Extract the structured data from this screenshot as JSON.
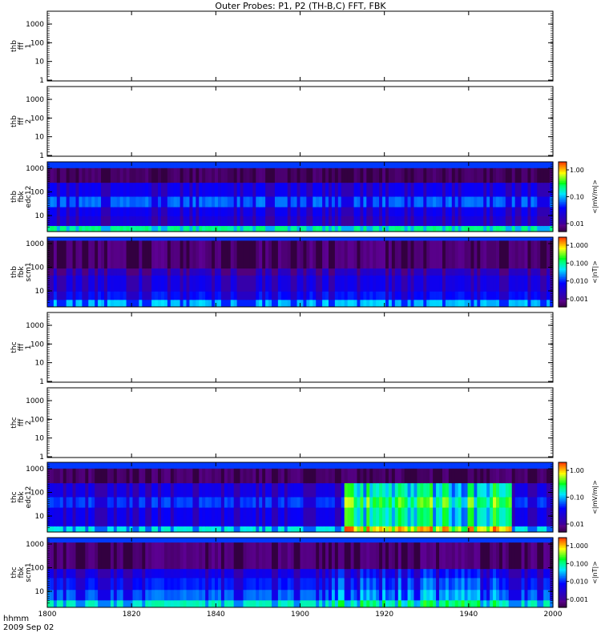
{
  "title": "Outer Probes: P1, P2 (TH-B,C) FFT, FBK",
  "xaxis": {
    "units_label": "hhmm",
    "date_label": "2009 Sep 02",
    "ticks": [
      "1800",
      "1820",
      "1840",
      "1900",
      "1920",
      "1940",
      "2000"
    ],
    "range_minutes": [
      0,
      120
    ]
  },
  "colors": {
    "frame": "#000000",
    "spectrogram_top_band": "#1f3cff",
    "background": "#ffffff"
  },
  "chart_data": [
    {
      "type": "heatmap",
      "ylabel_lines": [
        "thb",
        "fff",
        "1"
      ],
      "yscale": "log",
      "yticks": [
        "1",
        "10",
        "100",
        "1000"
      ],
      "ylim": [
        1,
        2000
      ],
      "data_present": false
    },
    {
      "type": "heatmap",
      "ylabel_lines": [
        "thb",
        "fff",
        "2"
      ],
      "yscale": "log",
      "yticks": [
        "1",
        "10",
        "100",
        "1000"
      ],
      "ylim": [
        1,
        2000
      ],
      "data_present": false
    },
    {
      "type": "heatmap",
      "ylabel_lines": [
        "thb",
        "fbk",
        "edc12"
      ],
      "yscale": "log",
      "yticks": [
        "10",
        "100",
        "1000"
      ],
      "colorbar": {
        "label": "<|mV/m|>",
        "ticks": [
          "1.00",
          "0.10",
          "0.01"
        ],
        "scale": "log"
      },
      "data_present": true,
      "bands_top_to_bottom": [
        "very high",
        "very low",
        "low",
        "low-mid",
        "low",
        "low",
        "high"
      ]
    },
    {
      "type": "heatmap",
      "ylabel_lines": [
        "thb",
        "fbk",
        "scm1"
      ],
      "yscale": "log",
      "yticks": [
        "10",
        "100",
        "1000"
      ],
      "colorbar": {
        "label": "<|nT|>",
        "ticks": [
          "1.000",
          "0.100",
          "0.010",
          "0.001"
        ],
        "scale": "log"
      },
      "data_present": true,
      "bands_top_to_bottom": [
        "high",
        "very low",
        "very low",
        "very low",
        "low",
        "low",
        "mid"
      ]
    },
    {
      "type": "heatmap",
      "ylabel_lines": [
        "thc",
        "fff",
        "1"
      ],
      "yscale": "log",
      "yticks": [
        "1",
        "10",
        "100",
        "1000"
      ],
      "ylim": [
        1,
        2000
      ],
      "data_present": false
    },
    {
      "type": "heatmap",
      "ylabel_lines": [
        "thc",
        "fff",
        "2"
      ],
      "yscale": "log",
      "yticks": [
        "1",
        "10",
        "100",
        "1000"
      ],
      "ylim": [
        1,
        2000
      ],
      "data_present": false
    },
    {
      "type": "heatmap",
      "ylabel_lines": [
        "thc",
        "fbk",
        "edc12"
      ],
      "yscale": "log",
      "yticks": [
        "10",
        "100",
        "1000"
      ],
      "colorbar": {
        "label": "<|mV/m|>",
        "ticks": [
          "1.00",
          "0.10",
          "0.01"
        ],
        "scale": "log"
      },
      "data_present": true,
      "activity_enhanced_minutes": [
        70,
        110
      ]
    },
    {
      "type": "heatmap",
      "ylabel_lines": [
        "thc",
        "fbk",
        "scm1"
      ],
      "yscale": "log",
      "yticks": [
        "10",
        "100",
        "1000"
      ],
      "colorbar": {
        "label": "<|nT|>",
        "ticks": [
          "1.000",
          "0.100",
          "0.010",
          "0.001"
        ],
        "scale": "log"
      },
      "data_present": true
    }
  ]
}
